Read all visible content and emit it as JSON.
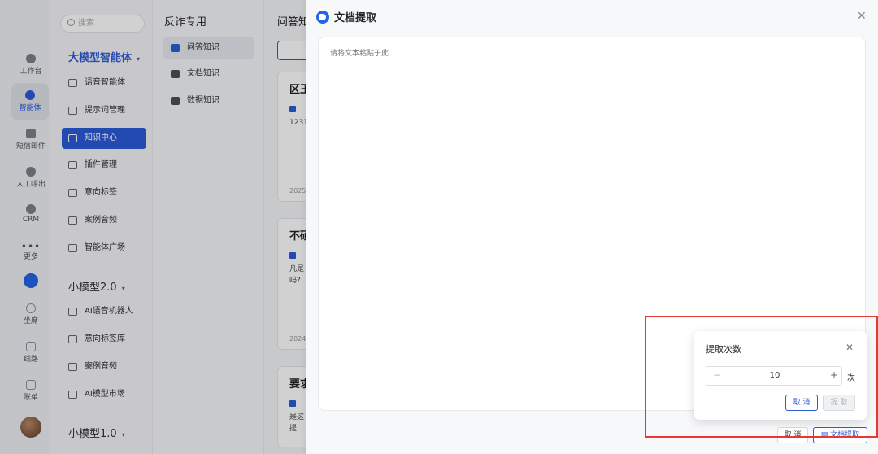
{
  "rail": {
    "items": [
      {
        "label": "工作台",
        "icon": "dashboard-icon"
      },
      {
        "label": "智能体",
        "icon": "agent-icon"
      },
      {
        "label": "短信邮件",
        "icon": "message-icon"
      },
      {
        "label": "人工呼出",
        "icon": "phone-out-icon"
      },
      {
        "label": "CRM",
        "icon": "crm-icon"
      },
      {
        "label": "更多",
        "icon": "more-icon"
      },
      {
        "label": "坐席",
        "icon": "headset-icon"
      },
      {
        "label": "线路",
        "icon": "route-icon"
      },
      {
        "label": "账单",
        "icon": "bill-icon"
      }
    ]
  },
  "sidebar": {
    "search_placeholder": "搜索",
    "group1": "大模型智能体",
    "group1_items": [
      "语音智能体",
      "提示词管理",
      "知识中心",
      "插件管理",
      "意向标签",
      "案例音频",
      "智能体广场"
    ],
    "group2": "小模型2.0",
    "group2_items": [
      "AI语音机器人",
      "意向标签库",
      "案例音频",
      "AI模型市场"
    ],
    "group3": "小模型1.0"
  },
  "knowledge": {
    "title": "反诈专用",
    "items": [
      "问答知识",
      "文档知识",
      "数据知识"
    ]
  },
  "content": {
    "title": "问答知",
    "cards": [
      {
        "title": "区王",
        "text": "1231",
        "date": "2025"
      },
      {
        "title": "不硕",
        "text": "凡是 吗?",
        "date": "2024"
      },
      {
        "title": "要求",
        "text": "是这 是提",
        "date": ""
      }
    ]
  },
  "drawer": {
    "title": "文档提取",
    "placeholder": "请将文本粘贴于此",
    "cancel_label": "取 消",
    "extract_label": "文档提取"
  },
  "popover": {
    "title": "提取次数",
    "value": "10",
    "unit": "次",
    "cancel_label": "取 消",
    "confirm_label": "提 取"
  },
  "colors": {
    "accent": "#2b5bd7",
    "highlight": "#e53935"
  }
}
